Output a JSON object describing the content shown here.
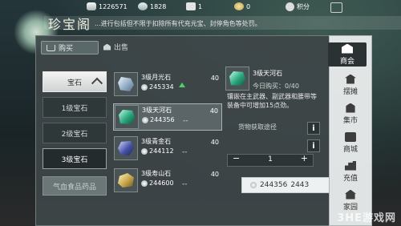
{
  "topbar": {
    "currency1": "1226571",
    "currency2": "1828",
    "currency3": "1",
    "currency4": "0",
    "score_label": "积分"
  },
  "header": {
    "title": "珍宝阁",
    "notice": "...进行包括但不限于扣除所有代充元宝、封停角色等处罚。"
  },
  "tabs": [
    {
      "label": "购买"
    },
    {
      "label": "出售"
    }
  ],
  "categories": {
    "header": "宝石",
    "items": [
      "1级宝石",
      "2级宝石",
      "3级宝石"
    ],
    "footer": "气血食品药品"
  },
  "items": [
    {
      "name": "3级月光石",
      "price": "245334",
      "qty": "40",
      "trend": ""
    },
    {
      "name": "3级天河石",
      "price": "244356",
      "qty": "40",
      "trend": "--"
    },
    {
      "name": "3级青金石",
      "price": "244112",
      "qty": "40",
      "trend": "--"
    },
    {
      "name": "3级寿山石",
      "price": "244600",
      "qty": "40",
      "trend": "--"
    }
  ],
  "detail": {
    "name": "3级天河石",
    "limit": "今日购买：0/40",
    "description": "镶嵌在主武器、副武器和腰带等装备中可增加15点劲。",
    "source_label": "货物获取途径",
    "quantity": "1",
    "total": "244356",
    "total_partial": "2443"
  },
  "nav": {
    "items": [
      "商会",
      "摆摊",
      "集市",
      "商城",
      "充值",
      "家园"
    ]
  },
  "watermark": "3HE游戏网",
  "colors": {
    "item_up_arrow": "#4bd06d",
    "panel": "#3e4648",
    "nav_active": "#2a3233"
  }
}
